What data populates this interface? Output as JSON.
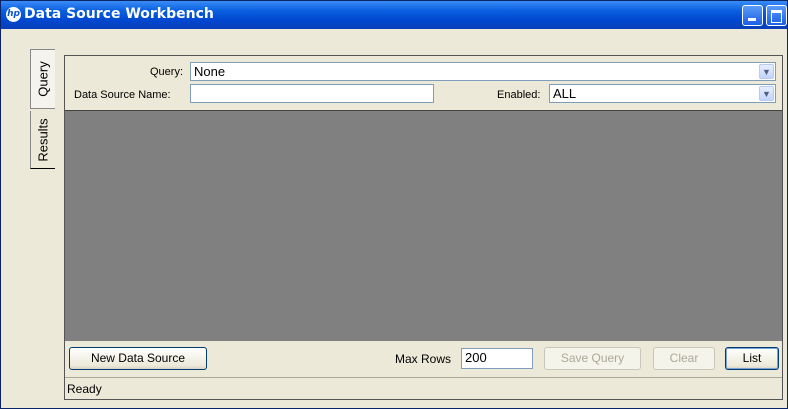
{
  "window": {
    "title": "Data Source Workbench",
    "logo": "hp"
  },
  "tabs": [
    {
      "label": "Query",
      "active": true
    },
    {
      "label": "Results",
      "active": false
    }
  ],
  "filter": {
    "query_label": "Query:",
    "query_value": "None",
    "name_label": "Data Source Name:",
    "name_value": "",
    "enabled_label": "Enabled:",
    "enabled_value": "ALL"
  },
  "toolbar": {
    "new_label": "New Data Source",
    "max_rows_label": "Max Rows",
    "max_rows_value": "200",
    "save_label": "Save Query",
    "clear_label": "Clear",
    "list_label": "List"
  },
  "status": {
    "text": "Ready"
  },
  "colors": {
    "titlebar": "#0047cf",
    "results_bg": "#808080",
    "chrome": "#ece9d8"
  }
}
